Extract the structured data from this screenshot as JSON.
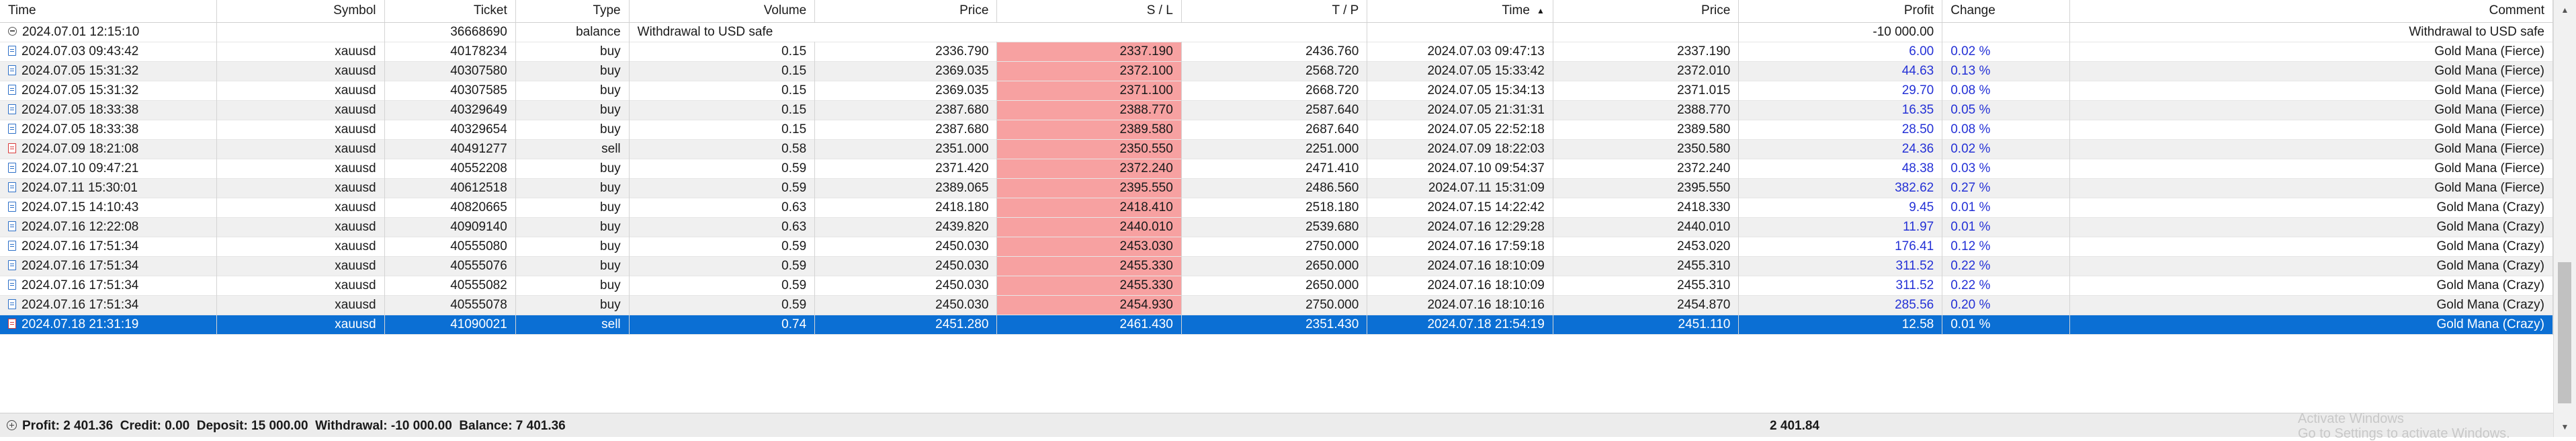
{
  "columns": {
    "time": "Time",
    "symbol": "Symbol",
    "ticket": "Ticket",
    "type": "Type",
    "volume": "Volume",
    "price": "Price",
    "sl": "S / L",
    "tp": "T / P",
    "close_time": "Time",
    "close_price": "Price",
    "profit": "Profit",
    "change": "Change",
    "comment": "Comment"
  },
  "sort_indicator": "▲",
  "balance_row": {
    "time": "2024.07.01 12:15:10",
    "ticket": "36668690",
    "type": "balance",
    "description": "Withdrawal to USD safe",
    "profit": "-10 000.00",
    "comment": "Withdrawal to USD safe"
  },
  "rows": [
    {
      "time": "2024.07.03 09:43:42",
      "symbol": "xauusd",
      "ticket": "40178234",
      "type": "buy",
      "volume": "0.15",
      "price": "2336.790",
      "sl": "2337.190",
      "tp": "2436.760",
      "close_time": "2024.07.03 09:47:13",
      "close_price": "2337.190",
      "profit": "6.00",
      "change": "0.02 %",
      "comment": "Gold Mana (Fierce)"
    },
    {
      "time": "2024.07.05 15:31:32",
      "symbol": "xauusd",
      "ticket": "40307580",
      "type": "buy",
      "volume": "0.15",
      "price": "2369.035",
      "sl": "2372.100",
      "tp": "2568.720",
      "close_time": "2024.07.05 15:33:42",
      "close_price": "2372.010",
      "profit": "44.63",
      "change": "0.13 %",
      "comment": "Gold Mana (Fierce)"
    },
    {
      "time": "2024.07.05 15:31:32",
      "symbol": "xauusd",
      "ticket": "40307585",
      "type": "buy",
      "volume": "0.15",
      "price": "2369.035",
      "sl": "2371.100",
      "tp": "2668.720",
      "close_time": "2024.07.05 15:34:13",
      "close_price": "2371.015",
      "profit": "29.70",
      "change": "0.08 %",
      "comment": "Gold Mana (Fierce)"
    },
    {
      "time": "2024.07.05 18:33:38",
      "symbol": "xauusd",
      "ticket": "40329649",
      "type": "buy",
      "volume": "0.15",
      "price": "2387.680",
      "sl": "2388.770",
      "tp": "2587.640",
      "close_time": "2024.07.05 21:31:31",
      "close_price": "2388.770",
      "profit": "16.35",
      "change": "0.05 %",
      "comment": "Gold Mana (Fierce)"
    },
    {
      "time": "2024.07.05 18:33:38",
      "symbol": "xauusd",
      "ticket": "40329654",
      "type": "buy",
      "volume": "0.15",
      "price": "2387.680",
      "sl": "2389.580",
      "tp": "2687.640",
      "close_time": "2024.07.05 22:52:18",
      "close_price": "2389.580",
      "profit": "28.50",
      "change": "0.08 %",
      "comment": "Gold Mana (Fierce)"
    },
    {
      "time": "2024.07.09 18:21:08",
      "symbol": "xauusd",
      "ticket": "40491277",
      "type": "sell",
      "volume": "0.58",
      "price": "2351.000",
      "sl": "2350.550",
      "tp": "2251.000",
      "close_time": "2024.07.09 18:22:03",
      "close_price": "2350.580",
      "profit": "24.36",
      "change": "0.02 %",
      "comment": "Gold Mana (Fierce)"
    },
    {
      "time": "2024.07.10 09:47:21",
      "symbol": "xauusd",
      "ticket": "40552208",
      "type": "buy",
      "volume": "0.59",
      "price": "2371.420",
      "sl": "2372.240",
      "tp": "2471.410",
      "close_time": "2024.07.10 09:54:37",
      "close_price": "2372.240",
      "profit": "48.38",
      "change": "0.03 %",
      "comment": "Gold Mana (Fierce)"
    },
    {
      "time": "2024.07.11 15:30:01",
      "symbol": "xauusd",
      "ticket": "40612518",
      "type": "buy",
      "volume": "0.59",
      "price": "2389.065",
      "sl": "2395.550",
      "tp": "2486.560",
      "close_time": "2024.07.11 15:31:09",
      "close_price": "2395.550",
      "profit": "382.62",
      "change": "0.27 %",
      "comment": "Gold Mana (Fierce)"
    },
    {
      "time": "2024.07.15 14:10:43",
      "symbol": "xauusd",
      "ticket": "40820665",
      "type": "buy",
      "volume": "0.63",
      "price": "2418.180",
      "sl": "2418.410",
      "tp": "2518.180",
      "close_time": "2024.07.15 14:22:42",
      "close_price": "2418.330",
      "profit": "9.45",
      "change": "0.01 %",
      "comment": "Gold Mana (Crazy)"
    },
    {
      "time": "2024.07.16 12:22:08",
      "symbol": "xauusd",
      "ticket": "40909140",
      "type": "buy",
      "volume": "0.63",
      "price": "2439.820",
      "sl": "2440.010",
      "tp": "2539.680",
      "close_time": "2024.07.16 12:29:28",
      "close_price": "2440.010",
      "profit": "11.97",
      "change": "0.01 %",
      "comment": "Gold Mana (Crazy)"
    },
    {
      "time": "2024.07.16 17:51:34",
      "symbol": "xauusd",
      "ticket": "40555080",
      "type": "buy",
      "volume": "0.59",
      "price": "2450.030",
      "sl": "2453.030",
      "tp": "2750.000",
      "close_time": "2024.07.16 17:59:18",
      "close_price": "2453.020",
      "profit": "176.41",
      "change": "0.12 %",
      "comment": "Gold Mana (Crazy)"
    },
    {
      "time": "2024.07.16 17:51:34",
      "symbol": "xauusd",
      "ticket": "40555076",
      "type": "buy",
      "volume": "0.59",
      "price": "2450.030",
      "sl": "2455.330",
      "tp": "2650.000",
      "close_time": "2024.07.16 18:10:09",
      "close_price": "2455.310",
      "profit": "311.52",
      "change": "0.22 %",
      "comment": "Gold Mana (Crazy)"
    },
    {
      "time": "2024.07.16 17:51:34",
      "symbol": "xauusd",
      "ticket": "40555082",
      "type": "buy",
      "volume": "0.59",
      "price": "2450.030",
      "sl": "2455.330",
      "tp": "2650.000",
      "close_time": "2024.07.16 18:10:09",
      "close_price": "2455.310",
      "profit": "311.52",
      "change": "0.22 %",
      "comment": "Gold Mana (Crazy)"
    },
    {
      "time": "2024.07.16 17:51:34",
      "symbol": "xauusd",
      "ticket": "40555078",
      "type": "buy",
      "volume": "0.59",
      "price": "2450.030",
      "sl": "2454.930",
      "tp": "2750.000",
      "close_time": "2024.07.16 18:10:16",
      "close_price": "2454.870",
      "profit": "285.56",
      "change": "0.20 %",
      "comment": "Gold Mana (Crazy)"
    },
    {
      "time": "2024.07.18 21:31:19",
      "symbol": "xauusd",
      "ticket": "41090021",
      "type": "sell",
      "volume": "0.74",
      "price": "2451.280",
      "sl": "2461.430",
      "tp": "2351.430",
      "close_time": "2024.07.18 21:54:19",
      "close_price": "2451.110",
      "profit": "12.58",
      "change": "0.01 %",
      "comment": "Gold Mana (Crazy)",
      "selected": true
    }
  ],
  "summary": {
    "text": "Profit: 2 401.36  Credit: 0.00  Deposit: 15 000.00  Withdrawal: -10 000.00  Balance: 7 401.36",
    "profit_total": "2 401.84"
  },
  "colors": {
    "sl_highlight": "#f7a1a1",
    "selected_row": "#0b6fd4",
    "profit_text": "#2431d6",
    "buy_icon": "#2c6fc7",
    "sell_icon": "#d83a3a"
  },
  "watermark": {
    "line1": "Activate Windows",
    "line2": "Go to Settings to activate Windows."
  }
}
